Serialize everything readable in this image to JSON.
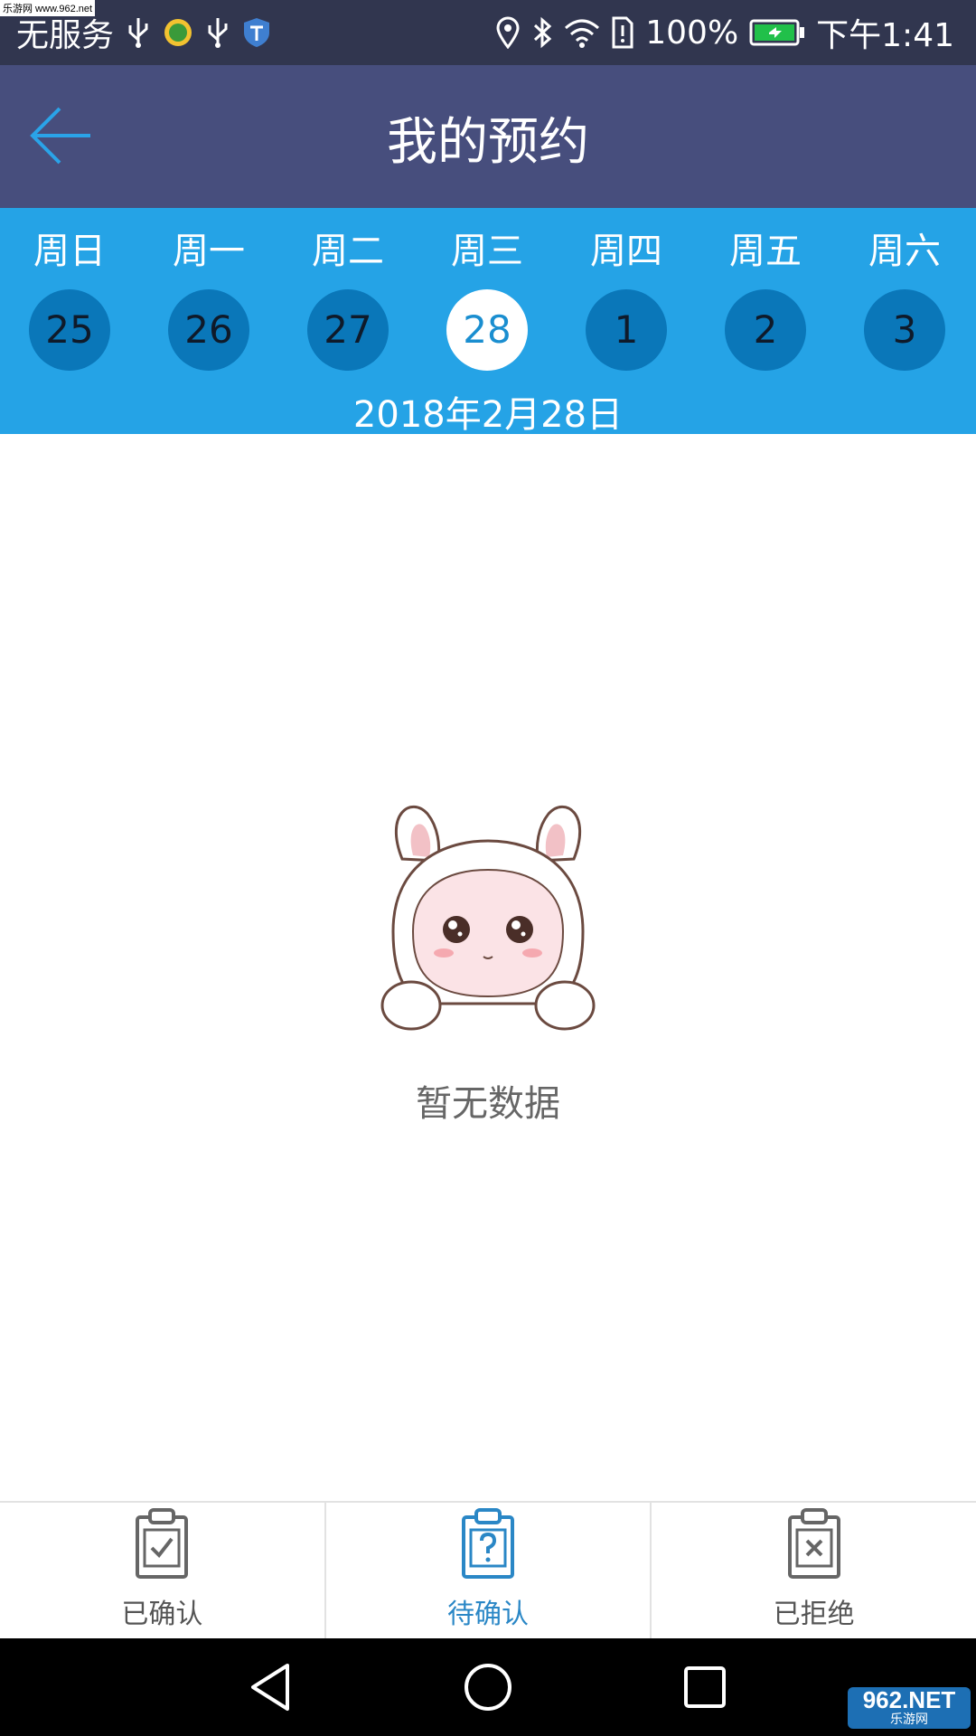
{
  "watermark_top": "乐游网 www.962.net",
  "status_bar": {
    "carrier": "无服务",
    "battery": "100%",
    "time": "下午1:41"
  },
  "header": {
    "title": "我的预约"
  },
  "week": {
    "days": [
      {
        "name": "周日",
        "date": "25",
        "selected": false
      },
      {
        "name": "周一",
        "date": "26",
        "selected": false
      },
      {
        "name": "周二",
        "date": "27",
        "selected": false
      },
      {
        "name": "周三",
        "date": "28",
        "selected": true
      },
      {
        "name": "周四",
        "date": "1",
        "selected": false
      },
      {
        "name": "周五",
        "date": "2",
        "selected": false
      },
      {
        "name": "周六",
        "date": "3",
        "selected": false
      }
    ],
    "selected_date_text": "2018年2月28日"
  },
  "empty_state": {
    "message": "暂无数据"
  },
  "tabs": [
    {
      "label": "已确认",
      "icon": "clipboard-check-icon",
      "active": false
    },
    {
      "label": "待确认",
      "icon": "clipboard-question-icon",
      "active": true
    },
    {
      "label": "已拒绝",
      "icon": "clipboard-x-icon",
      "active": false
    }
  ],
  "watermark": {
    "brand": "962.NET",
    "sub": "乐游网"
  },
  "colors": {
    "status_bar": "#31364f",
    "header": "#474e7d",
    "week_bar": "#25a3e6",
    "day_circle": "#0a77b9",
    "active_tab": "#2a87c6"
  }
}
